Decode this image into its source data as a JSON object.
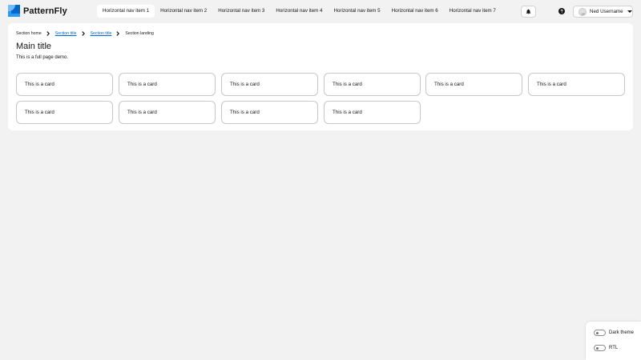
{
  "brand": {
    "name": "PatternFly"
  },
  "nav": {
    "items": [
      {
        "label": "Horizontal nav item 1",
        "current": true
      },
      {
        "label": "Horizontal nav item 2",
        "current": false
      },
      {
        "label": "Horizontal nav item 3",
        "current": false
      },
      {
        "label": "Horizontal nav item 4",
        "current": false
      },
      {
        "label": "Horizontal nav item 5",
        "current": false
      },
      {
        "label": "Horizontal nav item 6",
        "current": false
      },
      {
        "label": "Horizontal nav item 7",
        "current": false
      }
    ]
  },
  "toolbar": {
    "bell_icon": "bell-icon",
    "help_icon": "question-circle-icon",
    "user_name": "Ned Username",
    "user_caret_icon": "caret-down-icon"
  },
  "breadcrumb": {
    "items": [
      {
        "label": "Section home",
        "link": false
      },
      {
        "label": "Section title",
        "link": true
      },
      {
        "label": "Section title",
        "link": true
      },
      {
        "label": "Section landing",
        "link": false
      }
    ]
  },
  "page": {
    "title": "Main title",
    "description": "This is a full page demo."
  },
  "cards": [
    {
      "label": "This is a card"
    },
    {
      "label": "This is a card"
    },
    {
      "label": "This is a card"
    },
    {
      "label": "This is a card"
    },
    {
      "label": "This is a card"
    },
    {
      "label": "This is a card"
    },
    {
      "label": "This is a card"
    },
    {
      "label": "This is a card"
    },
    {
      "label": "This is a card"
    },
    {
      "label": "This is a card"
    }
  ],
  "theme_toggles": {
    "dark_theme_label": "Dark theme",
    "dark_theme_on": false,
    "rtl_label": "RTL",
    "rtl_on": false
  },
  "colors": {
    "brand_blue": "#0066cc",
    "link": "#0066cc",
    "page_background": "#f2f2f2"
  }
}
